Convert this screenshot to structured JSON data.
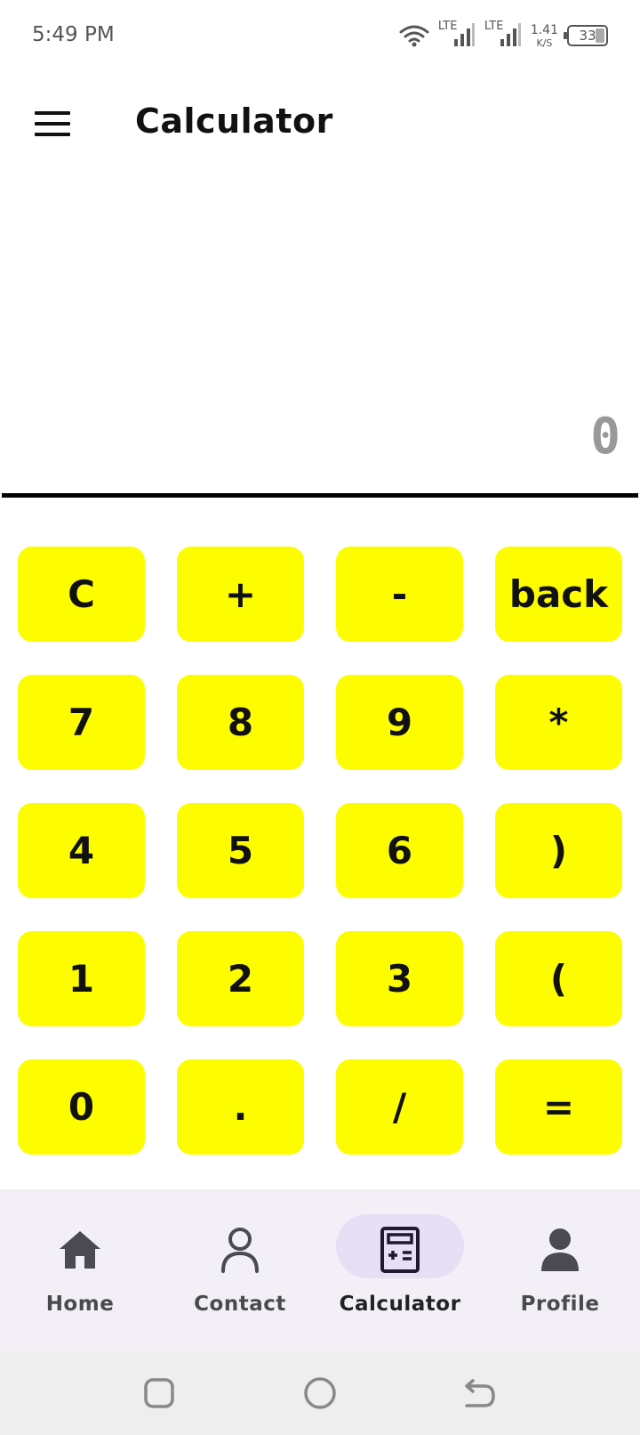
{
  "status_bar": {
    "time": "5:49 PM",
    "network_1": "LTE",
    "network_2": "LTE",
    "speed_value": "1.41",
    "speed_unit": "K/S",
    "battery": "33",
    "battery_level_percent": 33,
    "icons": [
      "wifi-icon",
      "signal-icon",
      "signal-icon",
      "battery-icon"
    ]
  },
  "app_bar": {
    "title": "Calculator",
    "menu_icon": "hamburger-menu-icon"
  },
  "display": {
    "value": "0"
  },
  "keypad": {
    "keys": [
      {
        "label": "C",
        "name": "clear"
      },
      {
        "label": "+",
        "name": "plus"
      },
      {
        "label": "-",
        "name": "minus"
      },
      {
        "label": "back",
        "name": "backspace"
      },
      {
        "label": "7",
        "name": "digit-7"
      },
      {
        "label": "8",
        "name": "digit-8"
      },
      {
        "label": "9",
        "name": "digit-9"
      },
      {
        "label": "*",
        "name": "multiply"
      },
      {
        "label": "4",
        "name": "digit-4"
      },
      {
        "label": "5",
        "name": "digit-5"
      },
      {
        "label": "6",
        "name": "digit-6"
      },
      {
        "label": ")",
        "name": "close-paren"
      },
      {
        "label": "1",
        "name": "digit-1"
      },
      {
        "label": "2",
        "name": "digit-2"
      },
      {
        "label": "3",
        "name": "digit-3"
      },
      {
        "label": "(",
        "name": "open-paren"
      },
      {
        "label": "0",
        "name": "digit-0"
      },
      {
        "label": ".",
        "name": "decimal"
      },
      {
        "label": "/",
        "name": "divide"
      },
      {
        "label": "=",
        "name": "equals"
      }
    ],
    "key_color": "#fdfd00"
  },
  "bottom_nav": {
    "items": [
      {
        "label": "Home",
        "icon": "home-icon",
        "active": false
      },
      {
        "label": "Contact",
        "icon": "person-outline-icon",
        "active": false
      },
      {
        "label": "Calculator",
        "icon": "calculator-icon",
        "active": true
      },
      {
        "label": "Profile",
        "icon": "person-filled-icon",
        "active": false
      }
    ],
    "background": "#f2eff6",
    "active_indicator": "#e6dff6"
  },
  "system_nav": {
    "buttons": [
      "recent-apps-icon",
      "home-circle-icon",
      "back-icon"
    ]
  }
}
